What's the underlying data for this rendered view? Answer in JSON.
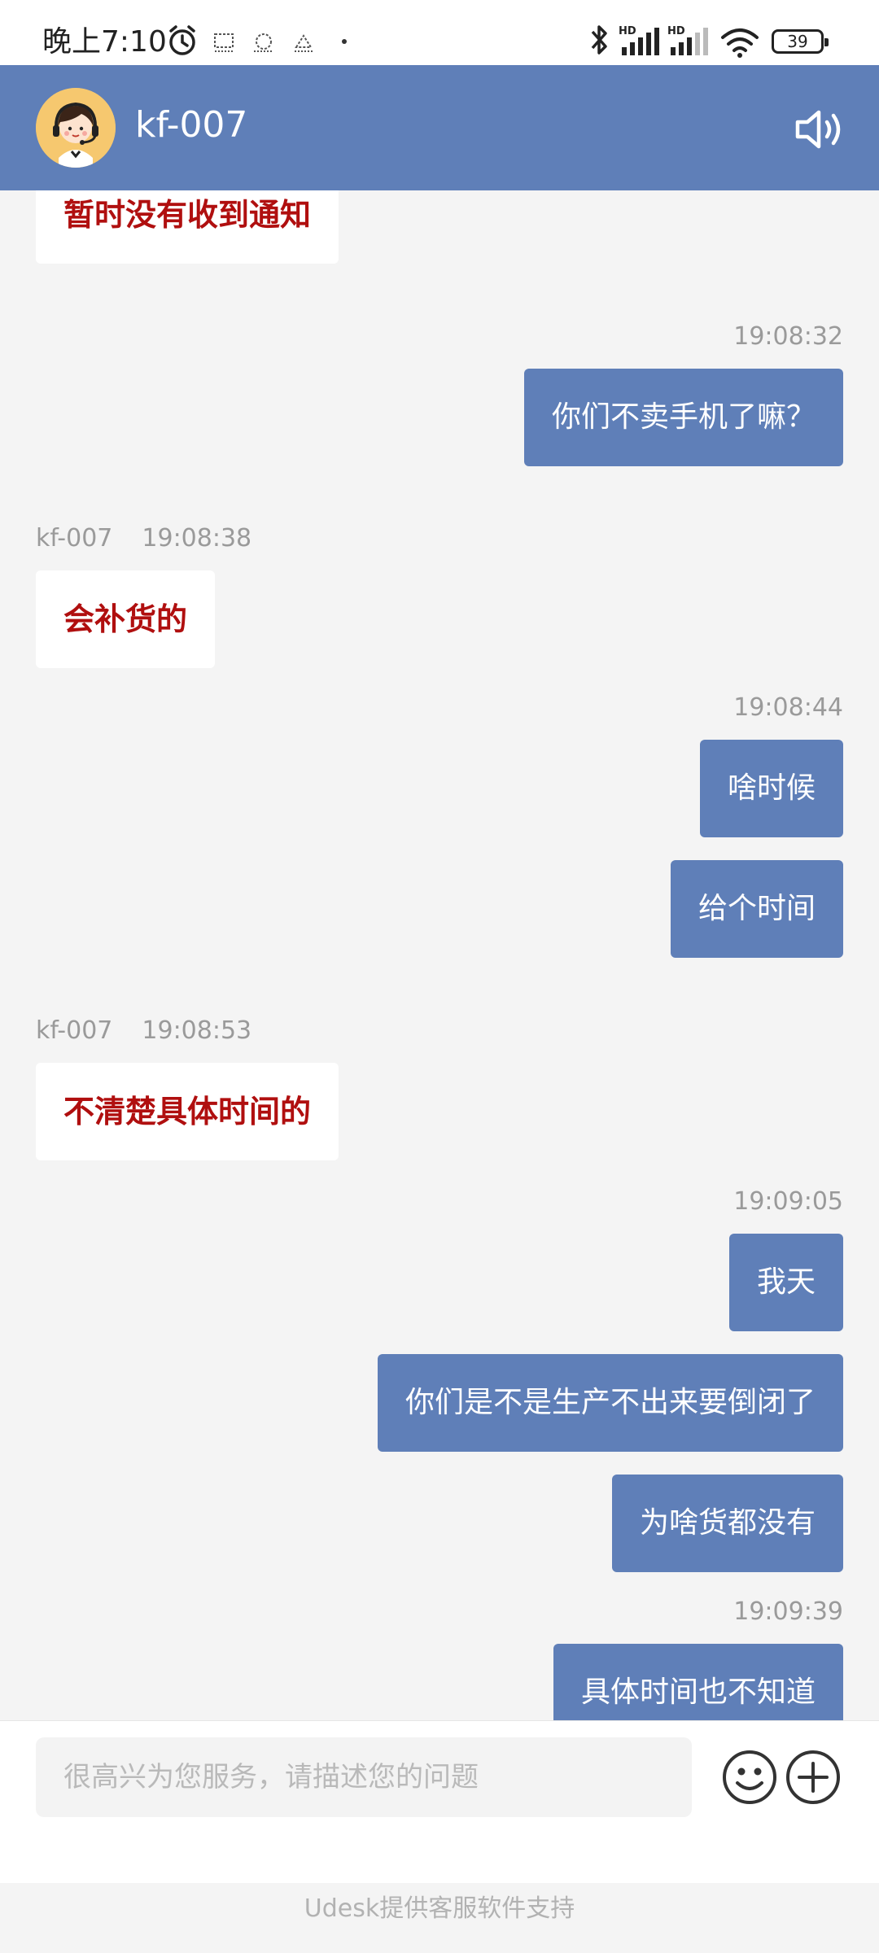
{
  "status_bar": {
    "time": "晚上7:10",
    "battery": "39",
    "icons": [
      "alarm-icon",
      "app-icon",
      "app-icon",
      "app-icon",
      "bluetooth-icon",
      "signal-icon",
      "signal-icon",
      "wifi-icon",
      "battery-icon"
    ]
  },
  "header": {
    "agent_name": "kf-007",
    "avatar_icon": "support-agent-avatar",
    "speaker_icon": "speaker-icon"
  },
  "messages": [
    {
      "side": "agent",
      "text": "暂时没有收到通知"
    },
    {
      "side": "user",
      "time": "19:08:32",
      "text": "你们不卖手机了嘛？"
    },
    {
      "side": "agent",
      "sender": "kf-007",
      "time": "19:08:38",
      "text": "会补货的"
    },
    {
      "side": "user",
      "time": "19:08:44",
      "text": "啥时候"
    },
    {
      "side": "user",
      "text": "给个时间"
    },
    {
      "side": "agent",
      "sender": "kf-007",
      "time": "19:08:53",
      "text": "不清楚具体时间的"
    },
    {
      "side": "user",
      "time": "19:09:05",
      "text": "我天"
    },
    {
      "side": "user",
      "text": "你们是不是生产不出来要倒闭了"
    },
    {
      "side": "user",
      "text": "为啥货都没有"
    },
    {
      "side": "user",
      "time": "19:09:39",
      "text": "具体时间也不知道"
    }
  ],
  "input": {
    "placeholder": "很高兴为您服务，请描述您的问题",
    "value": ""
  },
  "footer": {
    "powered_by": "Udesk提供客服软件支持"
  },
  "colors": {
    "header": "#5f7fb8",
    "user_bubble": "#5f7fb8",
    "agent_text": "#b00f0f",
    "background": "#f4f4f4"
  }
}
